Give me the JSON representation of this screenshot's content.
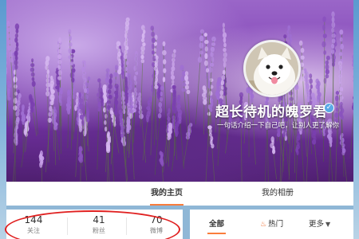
{
  "profile": {
    "nickname": "超长待机的魄罗君",
    "bio": "一句话介绍一下自己吧，让别人更了解你"
  },
  "tabs": [
    {
      "label": "我的主页",
      "active": true
    },
    {
      "label": "我的相册",
      "active": false
    }
  ],
  "stats": {
    "following": {
      "count": "144",
      "label": "关注"
    },
    "followers": {
      "count": "41",
      "label": "粉丝"
    },
    "weibo": {
      "count": "70",
      "label": "微博"
    }
  },
  "feed_filter": {
    "all_label": "全部",
    "hot_label": "热门",
    "more_label": "更多"
  },
  "colors": {
    "accent": "#fa7d3c",
    "annotation": "#e02020",
    "verified": "#5aa9e6"
  },
  "icons": [
    "verified-icon",
    "fire-icon",
    "chevron-down-icon"
  ]
}
